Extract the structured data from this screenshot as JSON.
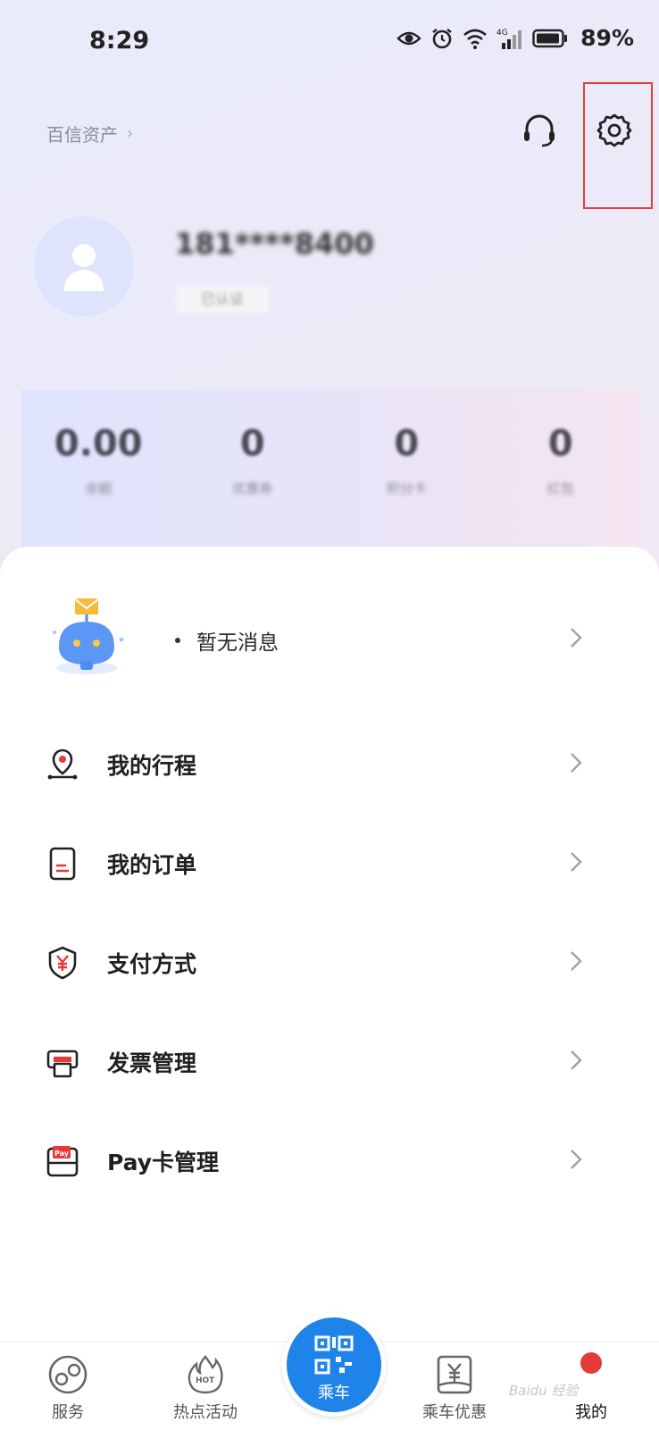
{
  "status_bar": {
    "time": "8:29",
    "battery": "89%"
  },
  "header": {
    "assets_label": "百信资产",
    "assets_chevron": "›"
  },
  "profile": {
    "username": "181****8400",
    "tag": "已认证"
  },
  "stats": [
    {
      "value": "0.00",
      "label": "余额"
    },
    {
      "value": "0",
      "label": "优惠券"
    },
    {
      "value": "0",
      "label": "积分卡"
    },
    {
      "value": "0",
      "label": "红包"
    }
  ],
  "message": {
    "text": "暂无消息"
  },
  "menu": [
    {
      "label": "我的行程",
      "icon": "location-icon"
    },
    {
      "label": "我的订单",
      "icon": "order-icon"
    },
    {
      "label": "支付方式",
      "icon": "shield-yen-icon"
    },
    {
      "label": "发票管理",
      "icon": "invoice-printer-icon"
    },
    {
      "label": "Pay卡管理",
      "icon": "pay-card-icon"
    }
  ],
  "tabbar": {
    "service": "服务",
    "hot": "热点活动",
    "ride": "乘车",
    "discount": "乘车优惠",
    "mine": "我的"
  },
  "watermark": "Baidu 经验",
  "colors": {
    "accent": "#1f84ea",
    "highlight": "#e0403a",
    "red": "#e53a3a"
  }
}
